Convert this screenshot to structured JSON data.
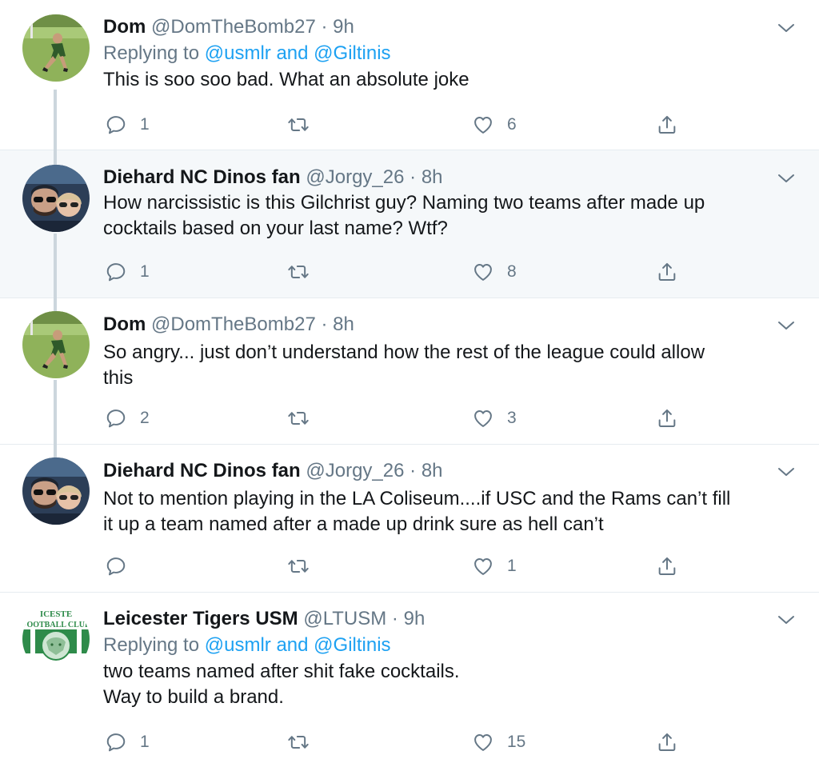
{
  "tweets": [
    {
      "name": "Dom",
      "handle": "@DomTheBomb27",
      "time": "9h",
      "replying_prefix": "Replying to",
      "replying_users": "@usmlr and @Giltinis",
      "text_lines": [
        "This is soo soo bad. What an absolute joke"
      ],
      "reply_count": "1",
      "retweet_count": "",
      "like_count": "6",
      "avatar": "soccer-player-avatar"
    },
    {
      "name": "Diehard NC Dinos fan",
      "handle": "@Jorgy_26",
      "time": "8h",
      "text_lines": [
        "How narcissistic is this Gilchrist guy? Naming two teams after made up",
        "cocktails based on your last name? Wtf?"
      ],
      "reply_count": "1",
      "retweet_count": "",
      "like_count": "8",
      "avatar": "couple-selfie-avatar"
    },
    {
      "name": "Dom",
      "handle": "@DomTheBomb27",
      "time": "8h",
      "text_lines": [
        "So angry... just don’t understand how the rest of the league could allow",
        "this"
      ],
      "reply_count": "2",
      "retweet_count": "",
      "like_count": "3",
      "avatar": "soccer-player-avatar"
    },
    {
      "name": "Diehard NC Dinos fan",
      "handle": "@Jorgy_26",
      "time": "8h",
      "text_lines": [
        "Not to mention playing in the LA Coliseum....if USC and the Rams can’t fill",
        "it up a team named after a made up drink sure as hell can’t"
      ],
      "reply_count": "",
      "retweet_count": "",
      "like_count": "1",
      "avatar": "couple-selfie-avatar"
    },
    {
      "name": "Leicester Tigers USM",
      "handle": "@LTUSM",
      "time": "9h",
      "replying_prefix": "Replying to",
      "replying_users": "@usmlr and @Giltinis",
      "text_lines": [
        "two teams named after shit fake cocktails.",
        "Way to build a brand."
      ],
      "reply_count": "1",
      "retweet_count": "",
      "like_count": "15",
      "avatar": "football-club-crest-avatar",
      "avatar_text": [
        "ICESTE",
        "FOOTBALL CLUB"
      ]
    }
  ],
  "separator": "·",
  "colors": {
    "text": "#14171a",
    "secondary": "#657786",
    "link": "#1da1f2",
    "highlight_bg": "#f5f8fa",
    "thread_line": "#ccd6dd",
    "divider": "#e6ecf0"
  },
  "icons": [
    "reply-icon",
    "retweet-icon",
    "like-icon",
    "share-icon",
    "chevron-down-icon"
  ]
}
